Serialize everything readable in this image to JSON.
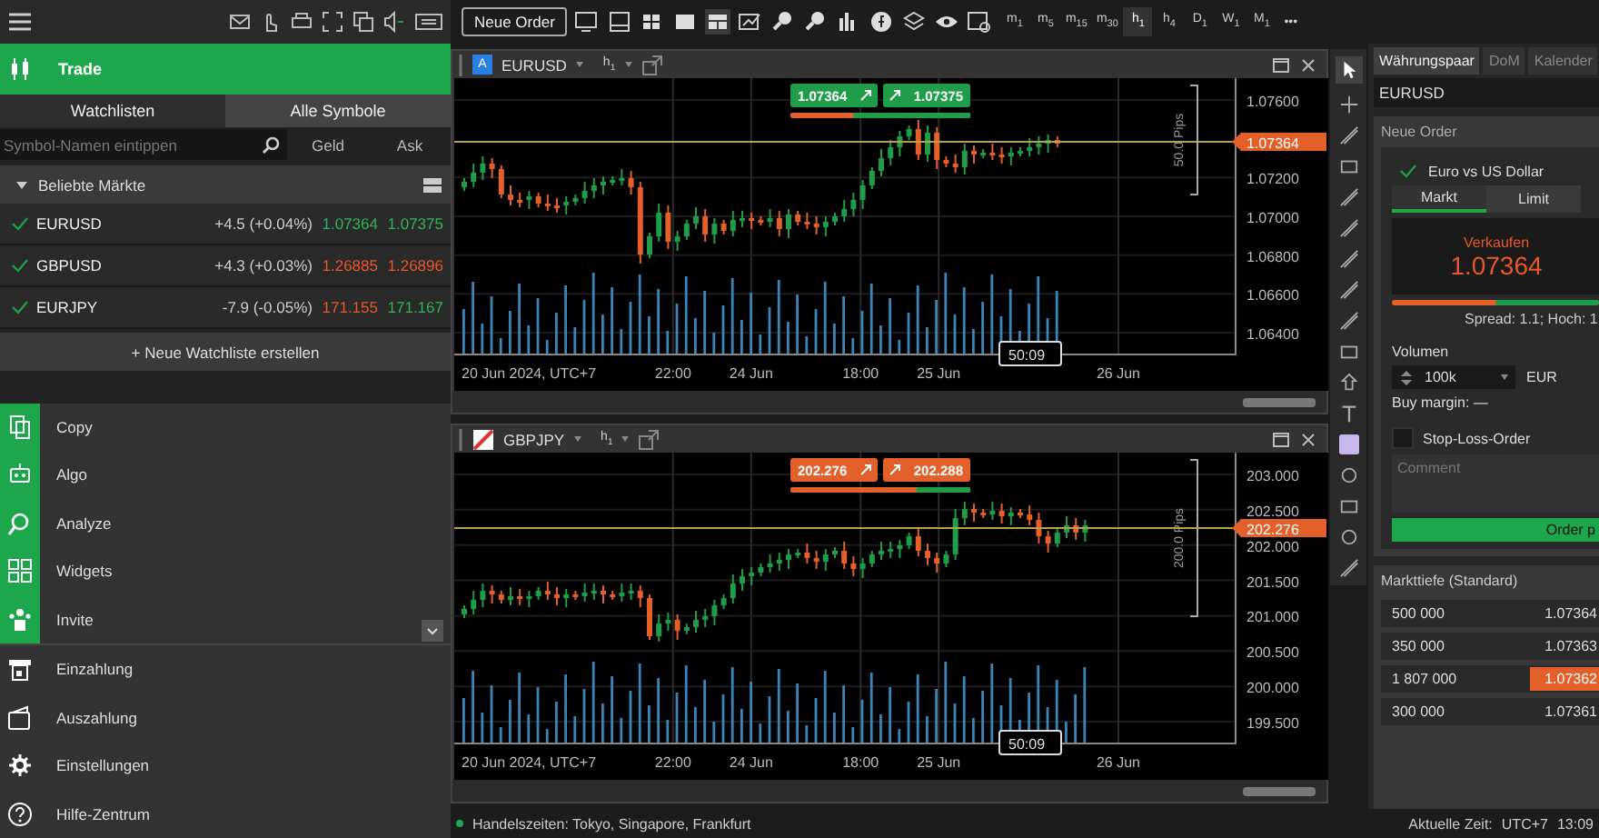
{
  "sidebar": {
    "section_title": "Trade",
    "tabs": [
      {
        "label": "Watchlisten",
        "selected": true
      },
      {
        "label": "Alle Symbole",
        "selected": false
      }
    ],
    "search": {
      "placeholder": "Symbol-Namen eintippen"
    },
    "columns": [
      "Geld",
      "Ask"
    ],
    "group": {
      "title": "Beliebte Märkte",
      "expanded": true
    },
    "rows": [
      {
        "symbol": "EURUSD",
        "checked": true,
        "change": "+4.5 (+0.04%)",
        "bid": {
          "price": "1.07364",
          "color": "#2fb35a"
        },
        "ask": {
          "price": "1.07375",
          "color": "#2fb35a"
        }
      },
      {
        "symbol": "GBPUSD",
        "checked": true,
        "change": "+4.3 (+0.03%)",
        "bid": {
          "price": "1.26885",
          "color": "#e8582a"
        },
        "ask": {
          "price": "1.26896",
          "color": "#e8582a"
        }
      },
      {
        "symbol": "EURJPY",
        "checked": true,
        "change": "-7.9 (-0.05%)",
        "bid": {
          "price": "171.155",
          "color": "#e8582a"
        },
        "ask": {
          "price": "171.167",
          "color": "#2fb35a"
        }
      }
    ],
    "new_watchlist": "+ Neue Watchliste erstellen",
    "nav": [
      {
        "label": "Copy",
        "highlighted": true
      },
      {
        "label": "Algo",
        "highlighted": true
      },
      {
        "label": "Analyze",
        "highlighted": true
      },
      {
        "label": "Widgets",
        "highlighted": true
      },
      {
        "label": "Invite",
        "highlighted": true
      },
      {
        "label": "Einzahlung",
        "highlighted": false
      },
      {
        "label": "Auszahlung",
        "highlighted": false
      },
      {
        "label": "Einstellungen",
        "highlighted": false
      },
      {
        "label": "Hilfe-Zentrum",
        "highlighted": false
      }
    ]
  },
  "toolbar": {
    "new_order": "Neue Order",
    "timeframes": [
      {
        "label": "m$_{1}$",
        "selected": false
      },
      {
        "label": "m$_{5}$",
        "selected": false
      },
      {
        "label": "m$_{15}$",
        "selected": false
      },
      {
        "label": "m$_{30}$",
        "selected": false
      },
      {
        "label": "h$_{1}$",
        "selected": true
      },
      {
        "label": "h$_{4}$",
        "selected": false
      },
      {
        "label": "D$_{1}$",
        "selected": false
      },
      {
        "label": "W$_{1}$",
        "selected": false
      },
      {
        "label": "M$_{1}$",
        "selected": false
      }
    ],
    "more": "•••"
  },
  "charts": [
    {
      "badge": "A",
      "symbol": "EURUSD",
      "timeframe": "h$_{1}$",
      "color": "#1f9d4b",
      "bid": "1.07364",
      "ask": "1.07375",
      "sentiment": {
        "level": 0.65
      },
      "price_labels": [
        "1.07600",
        "1.07200",
        "1.07000",
        "1.06800",
        "1.06600",
        "1.06400"
      ],
      "current_price": "1.07364",
      "range_label": "50.0 Pips",
      "time_labels": [
        "20 Jun 2024, UTC+7",
        "22:00",
        "24 Jun",
        "18:00",
        "25 Jun",
        "26 Jun"
      ],
      "countdown": "50:09"
    },
    {
      "symbol": "GBPJPY",
      "timeframe": "h$_{1}$",
      "color": "#e3602b",
      "bid": "202.276",
      "ask": "202.288",
      "sentiment": {
        "level": 0.3
      },
      "price_labels": [
        "203.000",
        "202.500",
        "202.000",
        "201.500",
        "201.000",
        "200.500",
        "200.000",
        "199.500"
      ],
      "current_price": "202.276",
      "range_label": "200.0 Pips",
      "time_labels": [
        "20 Jun 2024, UTC+7",
        "22:00",
        "24 Jun",
        "18:00",
        "25 Jun",
        "26 Jun"
      ],
      "countdown": "50:09"
    }
  ],
  "order_panel": {
    "tabs": [
      {
        "label": "Währungspaar",
        "selected": true
      },
      {
        "label": "DoM",
        "selected": false
      },
      {
        "label": "Kalender",
        "selected": false
      }
    ],
    "symbol": "EURUSD",
    "title": "Neue Order",
    "instrument": "Euro vs US Dollar",
    "order_types": [
      {
        "label": "Markt",
        "selected": true
      },
      {
        "label": "Limit",
        "selected": false
      }
    ],
    "sell_label": "Verkaufen",
    "sell_price": "1.07364",
    "sentiment": {
      "level": 0.5
    },
    "spread": "Spread: 1.1; Hoch: 1",
    "volume_label": "Volumen",
    "volume": "100k",
    "currency": "EUR",
    "margin": "Buy margin: —",
    "stop_loss": {
      "label": "Stop-Loss-Order",
      "checked": false
    },
    "comment": {
      "placeholder": "Comment"
    },
    "submit": "Order p"
  },
  "market_depth": {
    "title": "Markttiefe (Standard)",
    "rows": [
      {
        "volume": "500 000",
        "price": "1.07364",
        "highlighted": false
      },
      {
        "volume": "350 000",
        "price": "1.07363",
        "highlighted": false
      },
      {
        "volume": "1 807 000",
        "price": "1.07362",
        "highlighted": true
      },
      {
        "volume": "300 000",
        "price": "1.07361",
        "highlighted": false
      }
    ]
  },
  "status_bar": {
    "sessions": "Handelszeiten: Tokyo, Singapore, Frankfurt",
    "time_label": "Aktuelle Zeit:",
    "timezone": "UTC+7",
    "time": "13:09"
  }
}
